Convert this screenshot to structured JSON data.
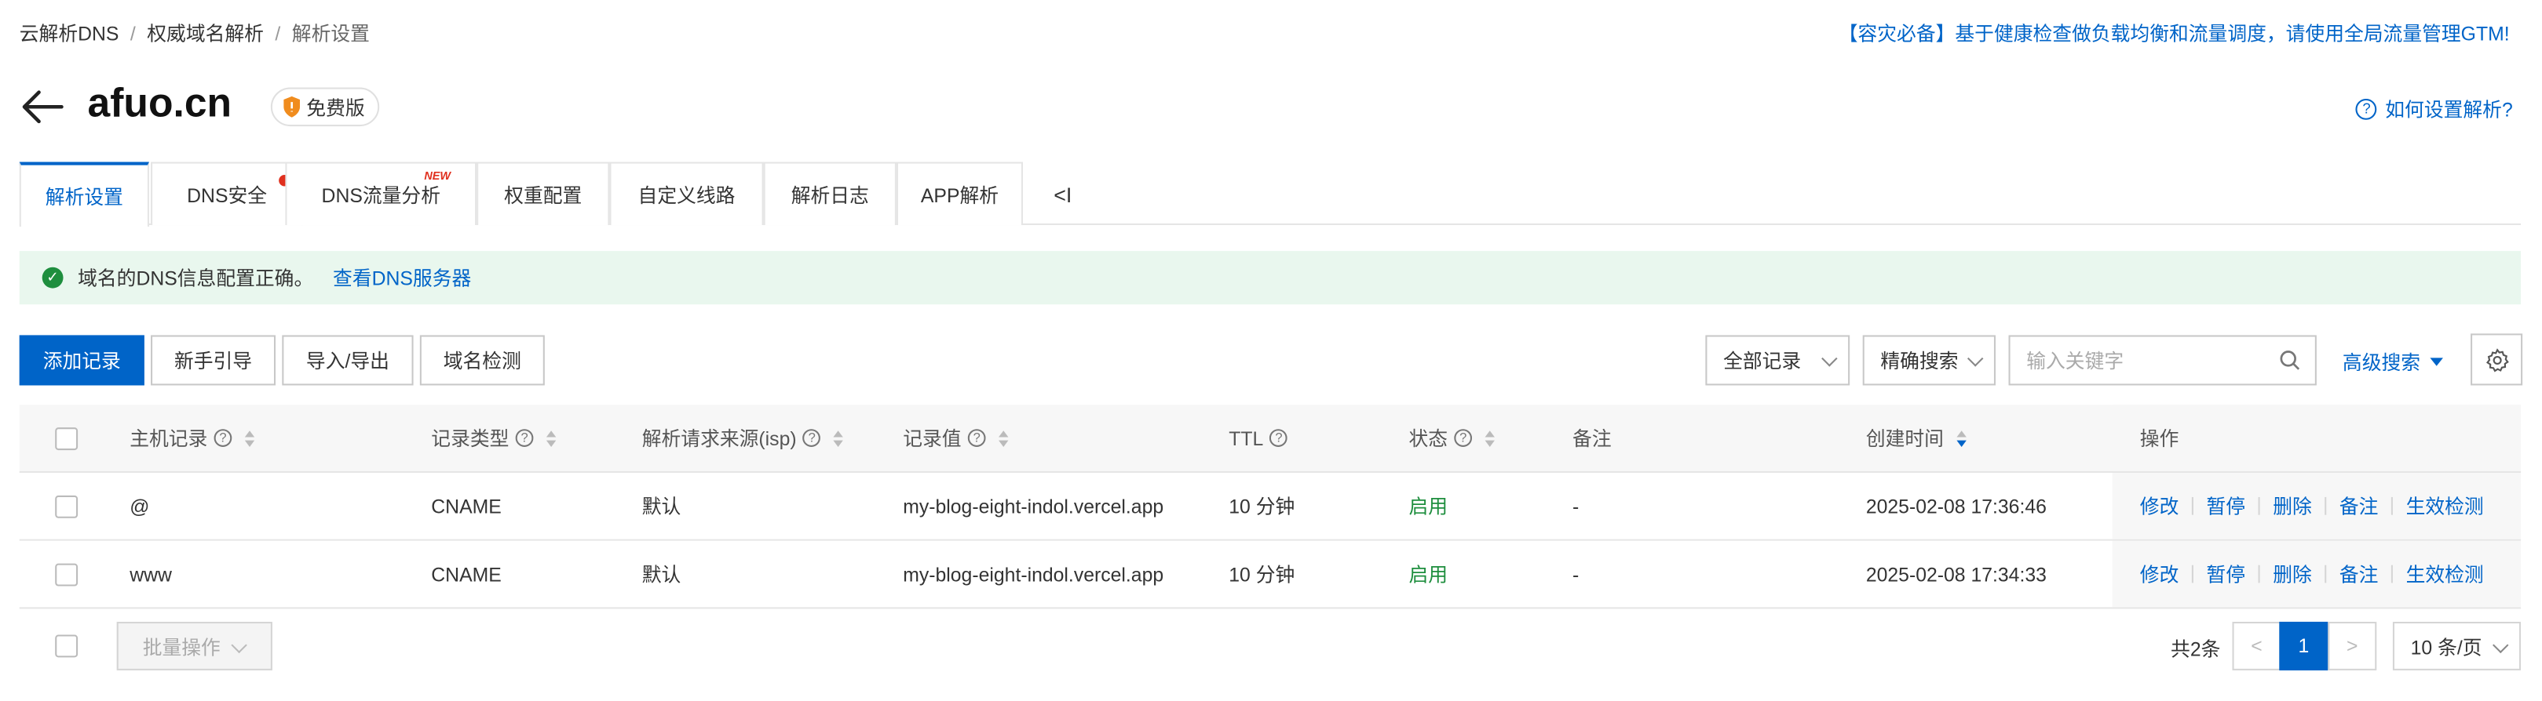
{
  "breadcrumb": {
    "items": [
      "云解析DNS",
      "权威域名解析"
    ],
    "current": "解析设置",
    "separator": "/"
  },
  "promo": {
    "text": "【容灾必备】基于健康检查做负载均衡和流量调度，请使用全局流量管理GTM!"
  },
  "header": {
    "domain": "afuo.cn",
    "edition_badge": "免费版",
    "help_link": "如何设置解析?",
    "help_icon_glyph": "?"
  },
  "tabs": [
    {
      "label": "解析设置",
      "active": true
    },
    {
      "label": "DNS安全",
      "has_dot": true
    },
    {
      "label": "DNS流量分析",
      "badge": "NEW"
    },
    {
      "label": "权重配置"
    },
    {
      "label": "自定义线路"
    },
    {
      "label": "解析日志"
    },
    {
      "label": "APP解析"
    }
  ],
  "tab_collapse_glyph": "<I",
  "alert": {
    "icon_glyph": "✓",
    "message": "域名的DNS信息配置正确。",
    "link": "查看DNS服务器"
  },
  "toolbar": {
    "add_record": "添加记录",
    "guide": "新手引导",
    "import_export": "导入/导出",
    "domain_check": "域名检测",
    "record_filter": "全部记录",
    "search_mode": "精确搜索",
    "search_placeholder": "输入关键字",
    "advanced_search": "高级搜索"
  },
  "table": {
    "columns": {
      "host": "主机记录",
      "type": "记录类型",
      "isp": "解析请求来源(isp)",
      "value": "记录值",
      "ttl": "TTL",
      "status": "状态",
      "remark": "备注",
      "created": "创建时间",
      "actions": "操作"
    },
    "help_glyph": "?",
    "rows": [
      {
        "host": "@",
        "type": "CNAME",
        "isp": "默认",
        "value": "my-blog-eight-indol.vercel.app",
        "ttl": "10 分钟",
        "status": "启用",
        "remark": "-",
        "created": "2025-02-08 17:36:46"
      },
      {
        "host": "www",
        "type": "CNAME",
        "isp": "默认",
        "value": "my-blog-eight-indol.vercel.app",
        "ttl": "10 分钟",
        "status": "启用",
        "remark": "-",
        "created": "2025-02-08 17:34:33"
      }
    ],
    "row_actions": [
      "修改",
      "暂停",
      "删除",
      "备注",
      "生效检测"
    ]
  },
  "footer": {
    "batch_ops": "批量操作",
    "total": "共2条",
    "prev_glyph": "<",
    "current_page": "1",
    "next_glyph": ">",
    "page_size": "10 条/页"
  },
  "colors": {
    "primary": "#0064c8",
    "success": "#1e8e3e",
    "alert_bg": "#e9f7ee",
    "danger": "#e0301e"
  }
}
